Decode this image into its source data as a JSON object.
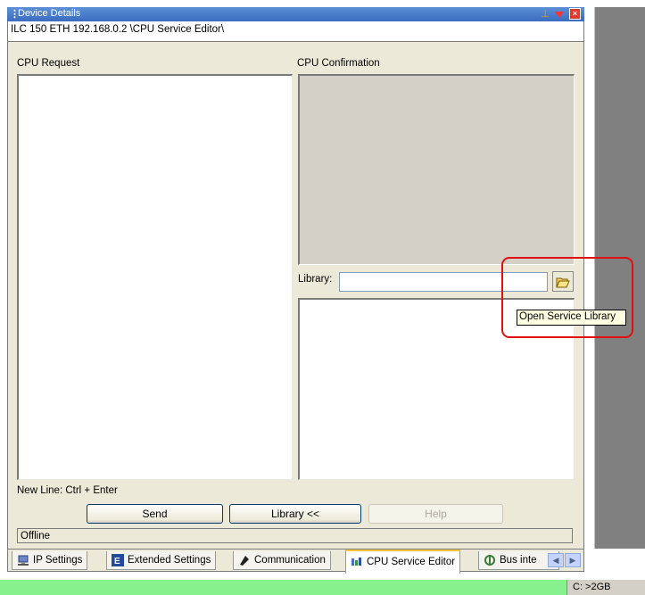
{
  "window": {
    "title": "Device Details",
    "path": "ILC 150 ETH 192.168.0.2 \\CPU Service Editor\\"
  },
  "cpu_request": {
    "label": "CPU Request"
  },
  "cpu_confirmation": {
    "label": "CPU Confirmation"
  },
  "library": {
    "label": "Library:",
    "value": "",
    "open_tooltip": "Open Service Library"
  },
  "hint": "New Line: Ctrl + Enter",
  "buttons": {
    "send": "Send",
    "library": "Library <<",
    "help": "Help"
  },
  "status": "Offline",
  "tabs": [
    {
      "label": "IP Settings",
      "icon": "ip-settings-icon",
      "active": false
    },
    {
      "label": "Extended Settings",
      "icon": "extended-settings-icon",
      "active": false
    },
    {
      "label": "Communication",
      "icon": "communication-icon",
      "active": false
    },
    {
      "label": "CPU Service Editor",
      "icon": "cpu-service-editor-icon",
      "active": true
    },
    {
      "label": "Bus inte",
      "icon": "bus-interface-icon",
      "active": false
    }
  ],
  "statusbar": {
    "disk": "C: >2GB"
  },
  "colors": {
    "highlight": "#e01010",
    "titlebar": "#3a6cc0",
    "statusbar_green": "#86f18d"
  }
}
